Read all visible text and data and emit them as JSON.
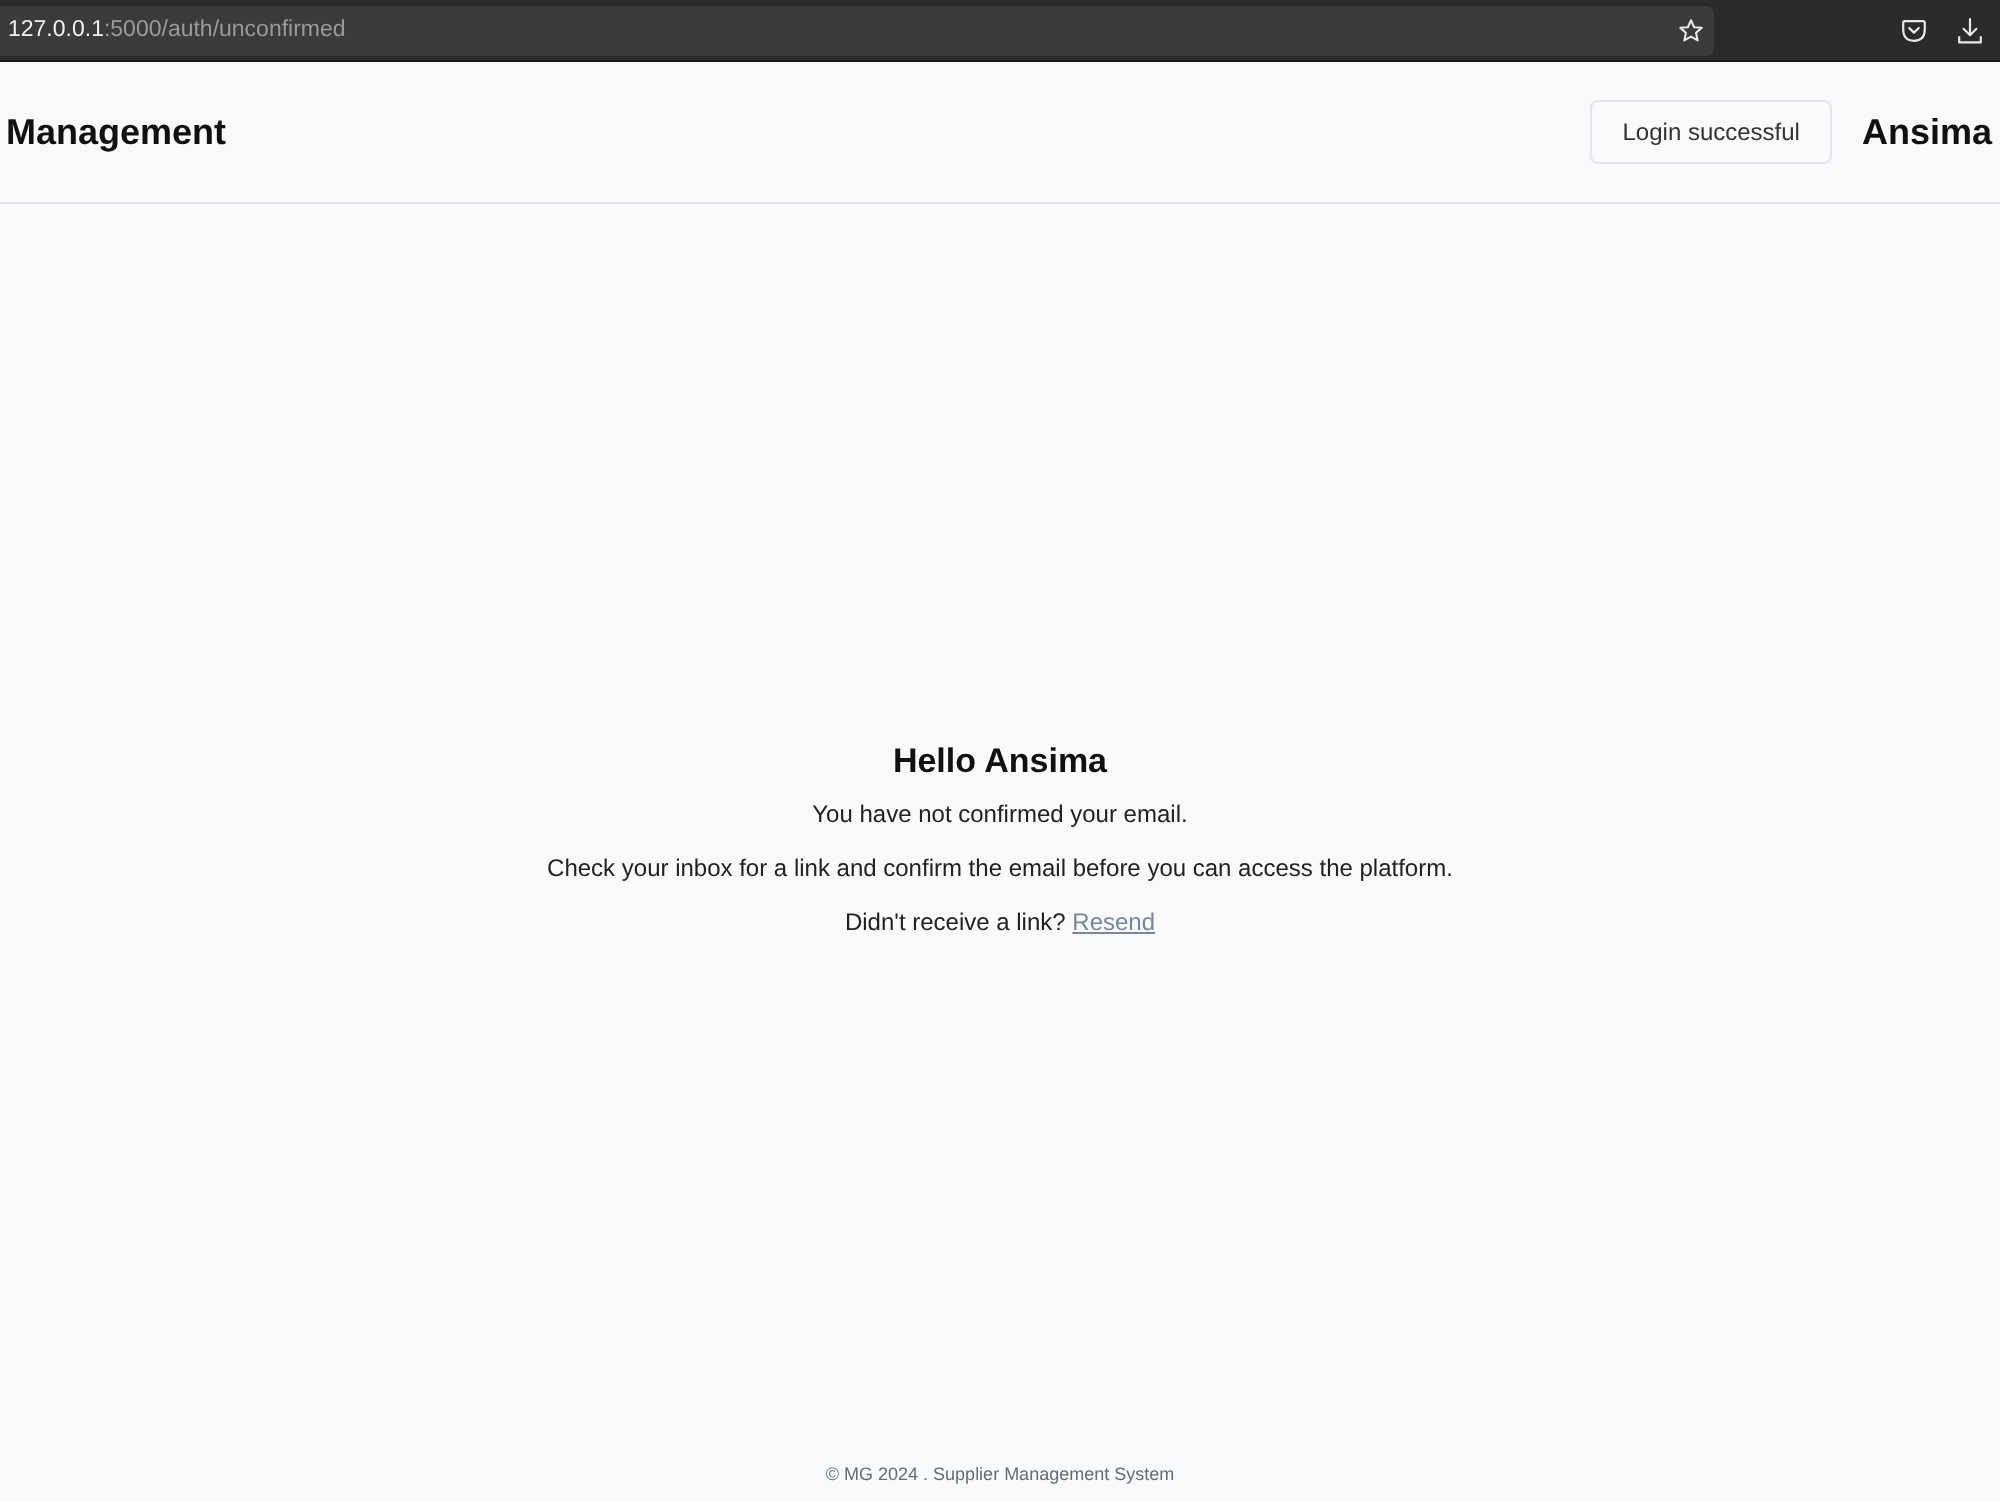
{
  "browser": {
    "url_host": "127.0.0.1",
    "url_path": ":5000/auth/unconfirmed"
  },
  "navbar": {
    "brand": "Management",
    "notice": "Login successful",
    "user": "Ansima"
  },
  "content": {
    "heading": "Hello Ansima",
    "lines": [
      "You have not confirmed your email.",
      "Check your inbox for a link and confirm the email before you can access the platform."
    ],
    "resend_prompt": "Didn't receive a link?",
    "resend_link": "Resend"
  },
  "footer": {
    "text": "© MG 2024 . Supplier Management System"
  }
}
